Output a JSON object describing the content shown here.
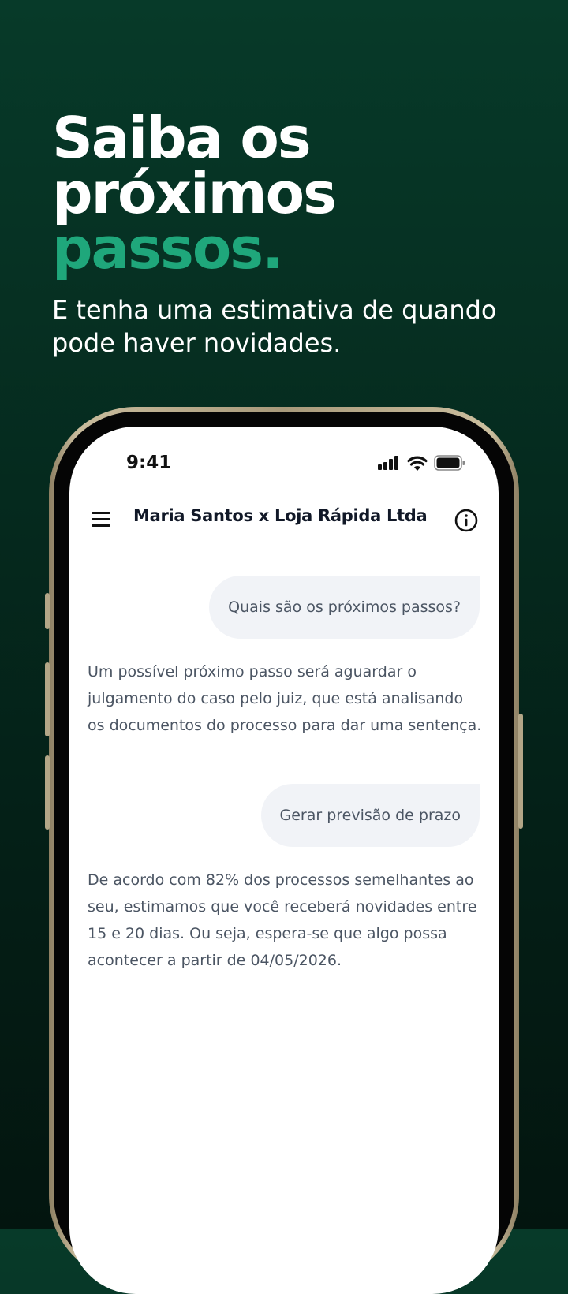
{
  "promo": {
    "headline_line1": "Saiba os",
    "headline_line2": "próximos",
    "headline_accent": "passos.",
    "subtitle": "E tenha uma estimativa de quando pode haver novidades."
  },
  "status_bar": {
    "time": "9:41"
  },
  "header": {
    "title": "Maria Santos x Loja Rápida Ltda"
  },
  "chat": {
    "messages": [
      {
        "role": "user",
        "text": "Quais são os próximos passos?"
      },
      {
        "role": "assistant",
        "text": "Um possível próximo passo será aguardar o julgamento do caso pelo juiz, que está analisando os documentos do processo para dar uma sentença."
      },
      {
        "role": "user",
        "text": "Gerar previsão de prazo"
      },
      {
        "role": "assistant",
        "text": "De acordo com 82% dos processos semelhantes ao seu, estimamos que você receberá novidades entre 15 e 20 dias. Ou seja, espera-se que algo possa acontecer a partir de 04/05/2026."
      }
    ]
  },
  "colors": {
    "background": "#062e22",
    "accent": "#1fa77b",
    "bubble": "#f1f3f7",
    "text_muted": "#4b5563"
  },
  "icons": [
    "signal-icon",
    "wifi-icon",
    "battery-icon",
    "menu-icon",
    "info-icon"
  ]
}
